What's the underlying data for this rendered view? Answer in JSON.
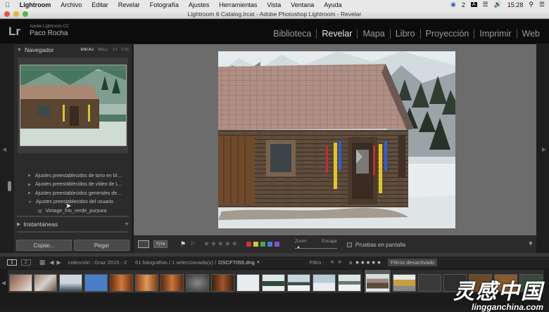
{
  "menubar": {
    "apple": "",
    "items": [
      "Lightroom",
      "Archivo",
      "Editar",
      "Revelar",
      "Fotografía",
      "Ajustes",
      "Herramientas",
      "Vista",
      "Ventana",
      "Ayuda"
    ],
    "badge": "2",
    "time": "15:28"
  },
  "window": {
    "title": "Lightroom 6 Catalog.lrcat - Adobe Photoshop Lightroom - Revelar"
  },
  "identity": {
    "logo": "Lr",
    "product": "Adobe Lightroom CC",
    "user": "Paco Rocha"
  },
  "modules": [
    "Biblioteca",
    "Revelar",
    "Mapa",
    "Libro",
    "Proyección",
    "Imprimir",
    "Web"
  ],
  "active_module": "Revelar",
  "navigator": {
    "title": "Navegador",
    "options": [
      "ENCAJ.",
      "RELL.",
      "1:1",
      "1:16"
    ]
  },
  "presets": [
    "Ajustes preestablecidos de tono en bl…",
    "Ajustes preestablecidos de vídeo de L…",
    "Ajustes preestablecidos generales de…",
    "Ajustes preestablecidos del usuario"
  ],
  "selected_preset": "Vintage_frio_verde_purpura",
  "snapshots": {
    "title": "Instantáneas",
    "plus": "+"
  },
  "buttons": {
    "copy": "Copiar...",
    "paste": "Pegar"
  },
  "toolbar": {
    "zoom_label": "Zoom",
    "fit_label": "Encajar",
    "proof_label": "Pruebas en pantalla",
    "color_labels": [
      "#cc3333",
      "#d8c23a",
      "#4fa34f",
      "#4a7ad0",
      "#8a52c8"
    ],
    "star_count": 5
  },
  "filmbar": {
    "page1": "1",
    "page2": "2",
    "collection": "colección : Graz 2015 - 2",
    "count": "61 fotografías / 1 seleccionada(s) /",
    "filename": "DSCF7055.dng",
    "filter_label": "Filtro :",
    "filter_value": "Filtros desactivado"
  },
  "watermark": {
    "text": "灵感中国",
    "url": "lingganchina.com"
  }
}
